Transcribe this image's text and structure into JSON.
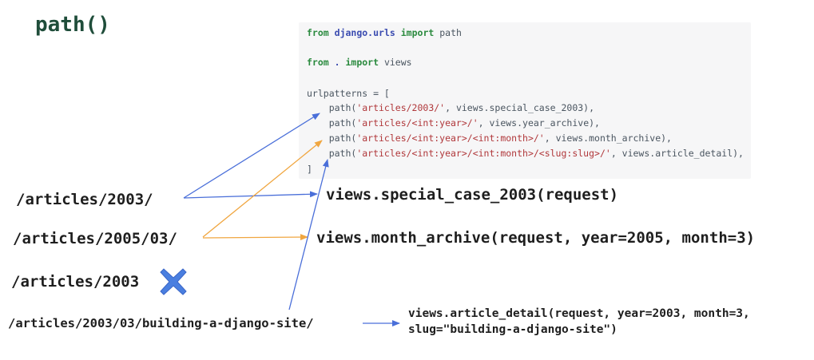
{
  "title": "path()",
  "code": {
    "import1": {
      "kw_from": "from",
      "module": "django.urls",
      "kw_import": "import",
      "name": " path"
    },
    "import2": {
      "kw_from": "from",
      "module": " . ",
      "kw_import": "import",
      "name": " views"
    },
    "urlpatterns_open": "urlpatterns = [",
    "patterns": [
      {
        "prefix": "    path(",
        "route": "'articles/2003/'",
        "suffix": ", views.special_case_2003),"
      },
      {
        "prefix": "    path(",
        "route": "'articles/<int:year>/'",
        "suffix": ", views.year_archive),"
      },
      {
        "prefix": "    path(",
        "route": "'articles/<int:year>/<int:month>/'",
        "suffix": ", views.month_archive),"
      },
      {
        "prefix": "    path(",
        "route": "'articles/<int:year>/<int:month>/<slug:slug>/'",
        "suffix": ", views.article_detail),"
      }
    ],
    "urlpatterns_close": "]"
  },
  "urls": {
    "url1": "/articles/2003/",
    "url2": "/articles/2005/03/",
    "url3": "/articles/2003",
    "url4": "/articles/2003/03/building-a-django-site/"
  },
  "views": {
    "view1": "views.special_case_2003(request)",
    "view2": "views.month_archive(request, year=2005, month=3)",
    "view3_line1": "views.article_detail(request, year=2003, month=3,",
    "view3_line2": "slug=\"building-a-django-site\")"
  },
  "colors": {
    "blue_arrow": "#4a6fd9",
    "orange_arrow": "#f0a640",
    "no_match_cross": "#4a7fe0"
  },
  "icons": {
    "no_match": "cross-icon"
  }
}
